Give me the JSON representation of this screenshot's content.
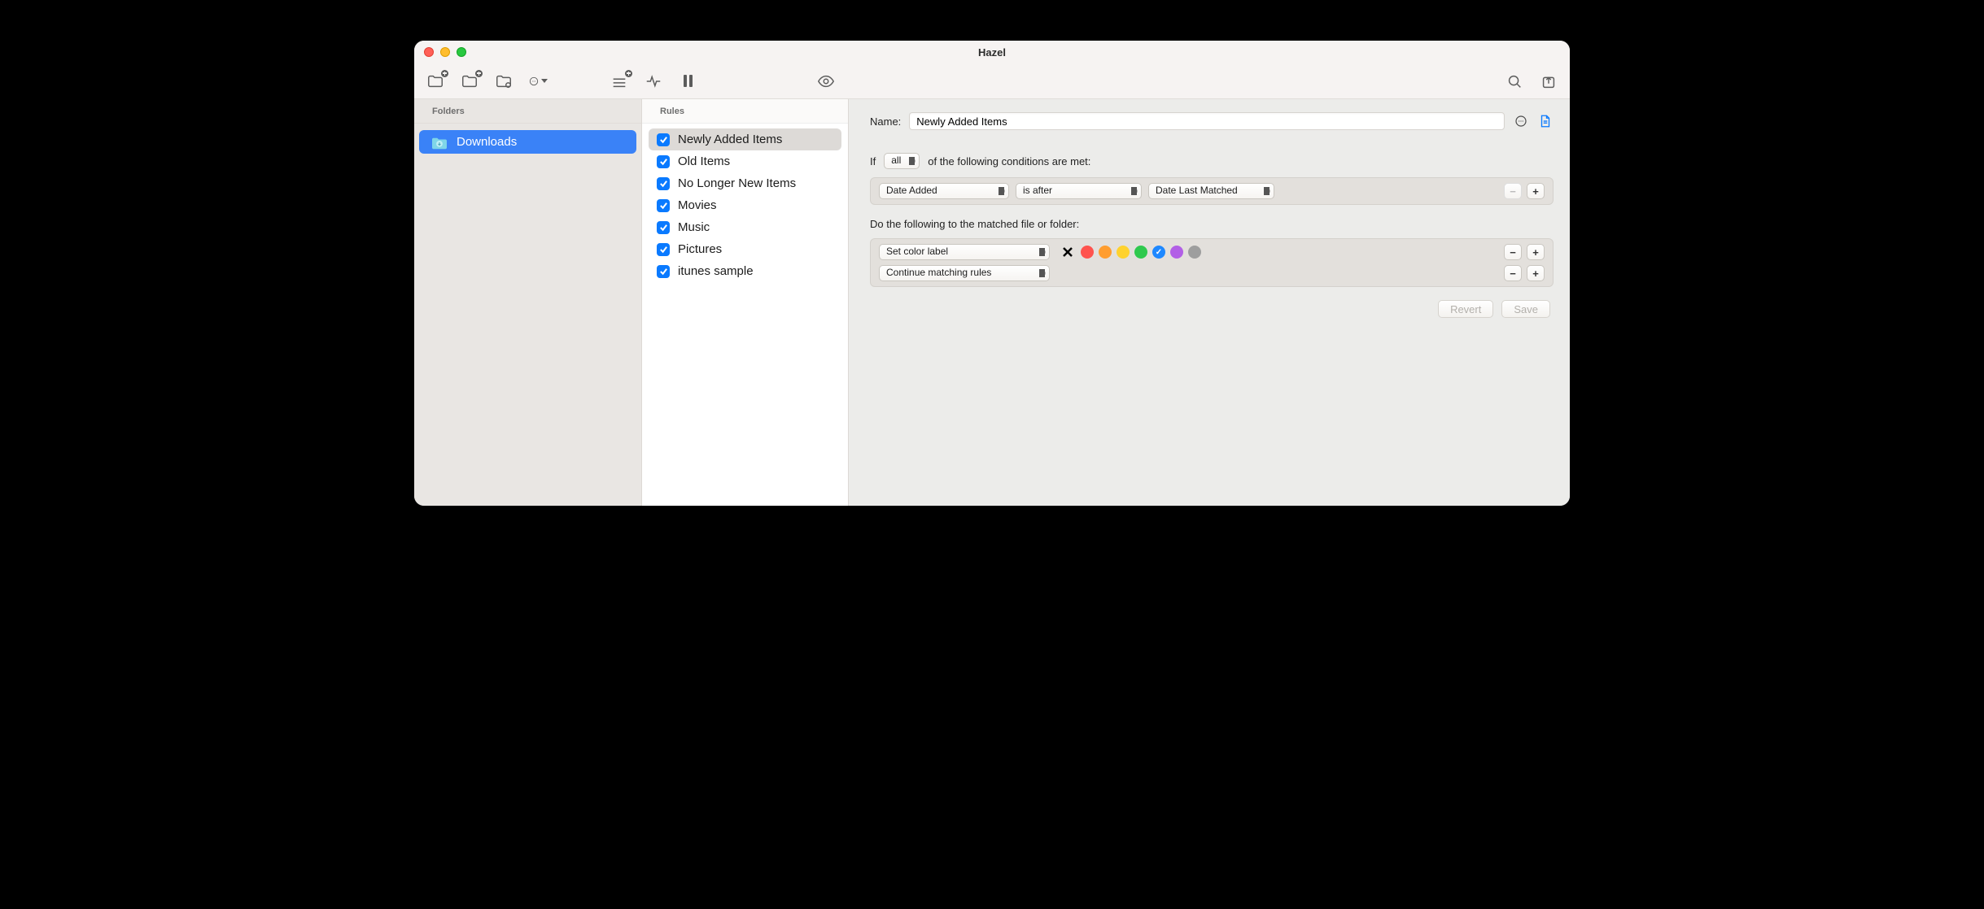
{
  "window": {
    "title": "Hazel"
  },
  "sidebar": {
    "header": "Folders",
    "folders": [
      {
        "name": "Downloads",
        "selected": true
      }
    ]
  },
  "rules": {
    "header": "Rules",
    "items": [
      {
        "label": "Newly Added Items",
        "checked": true,
        "selected": true
      },
      {
        "label": "Old Items",
        "checked": true,
        "selected": false
      },
      {
        "label": "No Longer New Items",
        "checked": true,
        "selected": false
      },
      {
        "label": "Movies",
        "checked": true,
        "selected": false
      },
      {
        "label": "Music",
        "checked": true,
        "selected": false
      },
      {
        "label": "Pictures",
        "checked": true,
        "selected": false
      },
      {
        "label": "itunes sample",
        "checked": true,
        "selected": false
      }
    ]
  },
  "editor": {
    "name_label": "Name:",
    "name_value": "Newly Added Items",
    "cond_prefix": "If",
    "cond_scope": "all",
    "cond_suffix": "of the following conditions are met:",
    "conditions": [
      {
        "attr": "Date Added",
        "op": "is after",
        "value": "Date Last Matched"
      }
    ],
    "actions_header": "Do the following to the matched file or folder:",
    "actions": [
      {
        "type": "Set color label",
        "colors": [
          {
            "name": "red",
            "hex": "#ff534e",
            "selected": false
          },
          {
            "name": "orange",
            "hex": "#ff9d2f",
            "selected": false
          },
          {
            "name": "yellow",
            "hex": "#ffd22e",
            "selected": false
          },
          {
            "name": "green",
            "hex": "#2fc94e",
            "selected": false
          },
          {
            "name": "blue",
            "hex": "#1e88ff",
            "selected": true
          },
          {
            "name": "purple",
            "hex": "#b25fe6",
            "selected": false
          },
          {
            "name": "gray",
            "hex": "#9e9e9e",
            "selected": false
          }
        ]
      },
      {
        "type": "Continue matching rules"
      }
    ],
    "buttons": {
      "revert": "Revert",
      "save": "Save"
    }
  }
}
